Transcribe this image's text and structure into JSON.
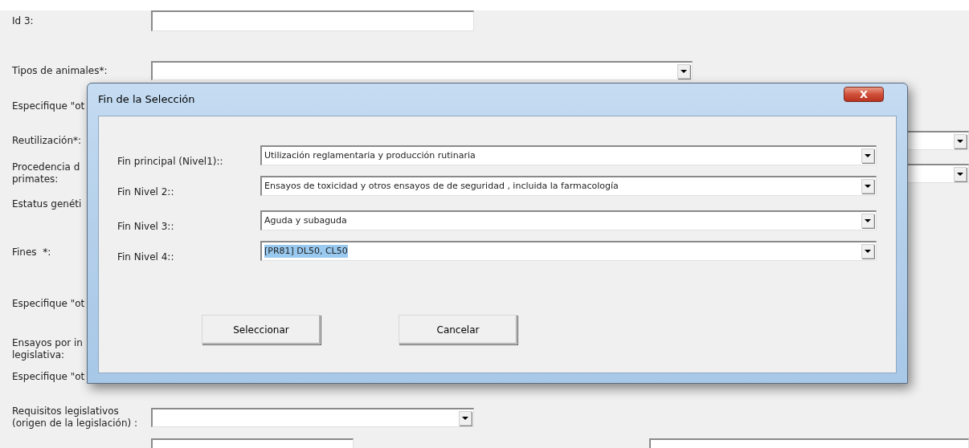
{
  "form": {
    "rows": [
      {
        "label": [
          "Id 3:"
        ],
        "kind": "shorttext"
      },
      {
        "label": [
          "Tipos de animales*:"
        ],
        "kind": "longselect"
      },
      {
        "label": [
          "Especifique \"ot"
        ],
        "kind": "label"
      },
      {
        "label": [
          "Reutilización*:"
        ],
        "kind": "wideselect"
      },
      {
        "label": [
          "Procedencia d",
          "primates:"
        ],
        "kind": "wideselect"
      },
      {
        "label": [
          "Estatus genéti"
        ],
        "kind": "label"
      },
      {
        "label": [
          "Fines  *:"
        ],
        "kind": "label"
      },
      {
        "label": [
          "Especifique \"ot"
        ],
        "kind": "label"
      },
      {
        "label": [
          "Ensayos por in",
          "legislativa:"
        ],
        "kind": "label"
      },
      {
        "label": [
          "Especifique \"ot"
        ],
        "kind": "label"
      },
      {
        "label": [
          "Requisitos legislativos",
          "(origen de la legislación) :"
        ],
        "kind": "shortselect"
      },
      {
        "kind": "pair"
      }
    ]
  },
  "dialog": {
    "title": "Fin de la Selección",
    "close": "X",
    "rows": [
      {
        "label": "Fin principal (Nivel1)::",
        "value": "Utilización reglamentaria y producción rutinaria",
        "highlighted": false
      },
      {
        "label": "Fin Nivel 2::",
        "value": "Ensayos de toxicidad y otros ensayos de de seguridad , incluida la farmacología",
        "highlighted": false
      },
      {
        "label": "Fin Nivel 3::",
        "value": "Aguda y subaguda",
        "highlighted": false
      },
      {
        "label": "Fin Nivel 4::",
        "value": "[PR81] DL50, CL50",
        "highlighted": true
      }
    ],
    "buttons": [
      "Seleccionar",
      "Cancelar"
    ]
  }
}
